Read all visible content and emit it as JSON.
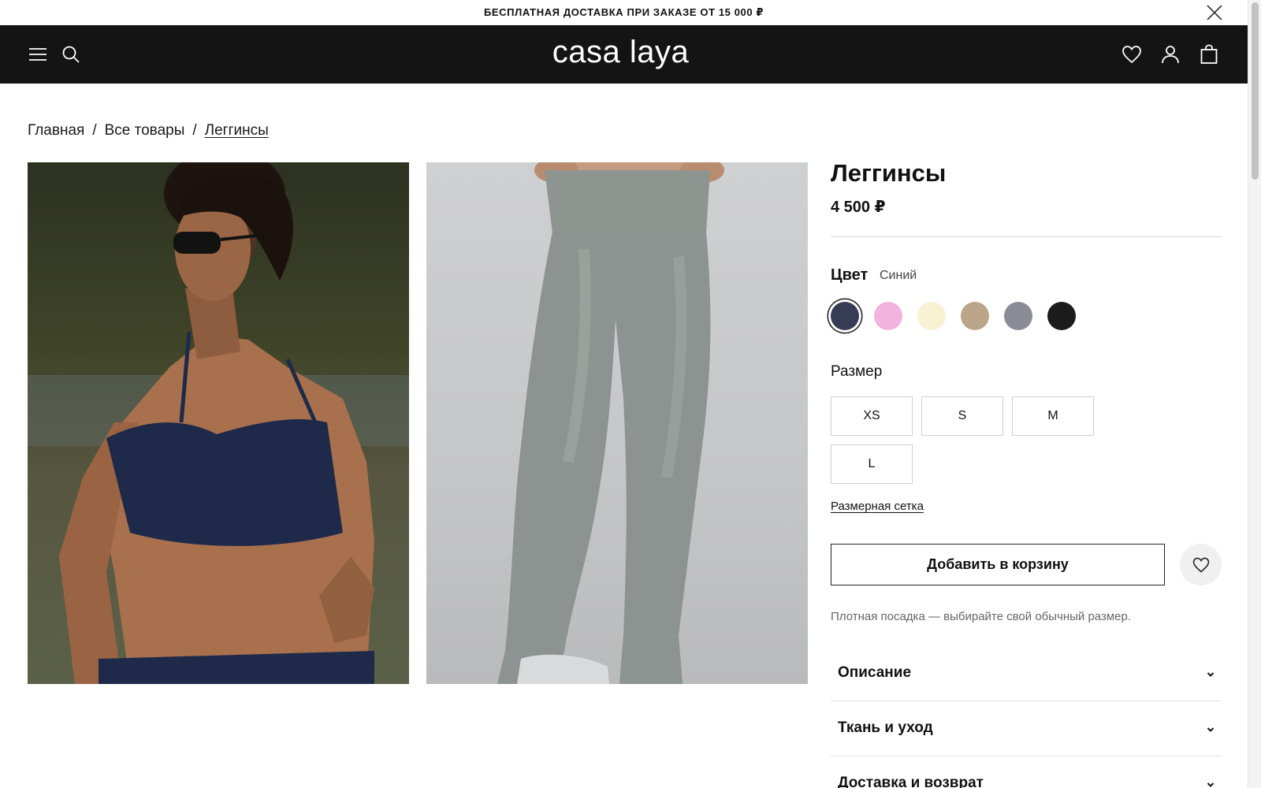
{
  "promo": {
    "text": "БЕСПЛАТНАЯ ДОСТАВКА ПРИ ЗАКАЗЕ ОТ 15 000 ₽"
  },
  "header": {
    "logo": "casa laya"
  },
  "breadcrumb": {
    "items": [
      "Главная",
      "Все товары",
      "Леггинсы"
    ],
    "separator": "/"
  },
  "product": {
    "title": "Леггинсы",
    "price": "4 500 ₽",
    "color_label": "Цвет",
    "selected_color": "Синий",
    "colors": [
      "#373c55",
      "#f2b3df",
      "#f8f1d2",
      "#bba68a",
      "#8a8c96",
      "#1b1b1b"
    ],
    "size_label": "Размер",
    "sizes": [
      "XS",
      "S",
      "M",
      "L"
    ],
    "size_chart_link": "Размерная сетка",
    "add_to_cart": "Добавить в корзину",
    "fit_note": "Плотная посадка — выбирайте свой обычный размер."
  },
  "accordion": [
    {
      "label": "Описание"
    },
    {
      "label": "Ткань и уход"
    },
    {
      "label": "Доставка и возврат"
    }
  ],
  "icons": {
    "promo_close": "close-icon",
    "menu": "hamburger-menu-icon",
    "search": "search-icon",
    "wishlist": "heart-icon",
    "account": "user-icon",
    "cart": "shopping-bag-icon"
  }
}
